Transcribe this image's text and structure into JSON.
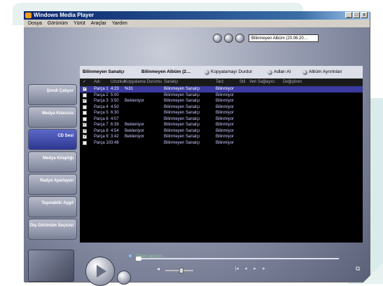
{
  "window": {
    "title": "Windows Media Player",
    "buttons": [
      "_",
      "□",
      "x"
    ]
  },
  "menu": [
    "Dosya",
    "Görünüm",
    "Yürüt",
    "Araçlar",
    "Yardım"
  ],
  "topbar": {
    "album_select": "Bilinmeyen Albüm (20.06.20…"
  },
  "sidebar": {
    "items": [
      {
        "label": "Şimdi Çalıyor",
        "active": false
      },
      {
        "label": "Medya Kılavuzu",
        "active": false
      },
      {
        "label": "CD Sesi",
        "active": true
      },
      {
        "label": "Medya Kitaplığı",
        "active": false
      },
      {
        "label": "Radyo Ayarlayıcı",
        "active": false
      },
      {
        "label": "Taşınabilir Aygıt",
        "active": false
      },
      {
        "label": "Dış Görünüm Seçicisi",
        "active": false
      }
    ]
  },
  "cd_header": {
    "artist": "Bilinmeyen Sanatçı",
    "album": "Bilinmeyen Albüm (2…",
    "actions": [
      "Kopyalamayı Durdur",
      "Adları Al",
      "Albüm Ayrıntıları"
    ]
  },
  "columns": [
    "Adı",
    "Uzunluk",
    "Kopyalama Durumu",
    "Sanatçı",
    "Tarz",
    "Stil",
    "Veri Sağlayıcı",
    "Değiştiren"
  ],
  "tracks": [
    {
      "name": "Parça 1",
      "length": "4:23",
      "status": "%31",
      "artist": "Bilinmeyen Sanatçı",
      "genre": "Bilinmiyor",
      "checked": true,
      "selected": true
    },
    {
      "name": "Parça 2",
      "length": "5:00",
      "status": "",
      "artist": "Bilinmeyen Sanatçı",
      "genre": "Bilinmiyor",
      "checked": false,
      "selected": false
    },
    {
      "name": "Parça 3",
      "length": "3:50",
      "status": "Bekleniyor",
      "artist": "Bilinmeyen Sanatçı",
      "genre": "Bilinmiyor",
      "checked": true,
      "selected": false
    },
    {
      "name": "Parça 4",
      "length": "4:50",
      "status": "",
      "artist": "Bilinmeyen Sanatçı",
      "genre": "Bilinmiyor",
      "checked": false,
      "selected": false
    },
    {
      "name": "Parça 5",
      "length": "6:30",
      "status": "",
      "artist": "Bilinmeyen Sanatçı",
      "genre": "Bilinmiyor",
      "checked": false,
      "selected": false
    },
    {
      "name": "Parça 6",
      "length": "4:07",
      "status": "",
      "artist": "Bilinmeyen Sanatçı",
      "genre": "Bilinmiyor",
      "checked": false,
      "selected": false
    },
    {
      "name": "Parça 7",
      "length": "6:39",
      "status": "Bekleniyor",
      "artist": "Bilinmeyen Sanatçı",
      "genre": "Bilinmiyor",
      "checked": true,
      "selected": false
    },
    {
      "name": "Parça 8",
      "length": "4:54",
      "status": "Bekleniyor",
      "artist": "Bilinmeyen Sanatçı",
      "genre": "Bilinmiyor",
      "checked": true,
      "selected": false
    },
    {
      "name": "Parça 9",
      "length": "3:42",
      "status": "Bekleniyor",
      "artist": "Bilinmeyen Sanatçı",
      "genre": "Bilinmiyor",
      "checked": true,
      "selected": false
    },
    {
      "name": "Parça 10",
      "length": "3:48",
      "status": "",
      "artist": "Bilinmeyen Sanatçı",
      "genre": "Bilinmiyor",
      "checked": false,
      "selected": false
    }
  ],
  "status": "Ortam açılıyor…",
  "volume_level": 0.6
}
